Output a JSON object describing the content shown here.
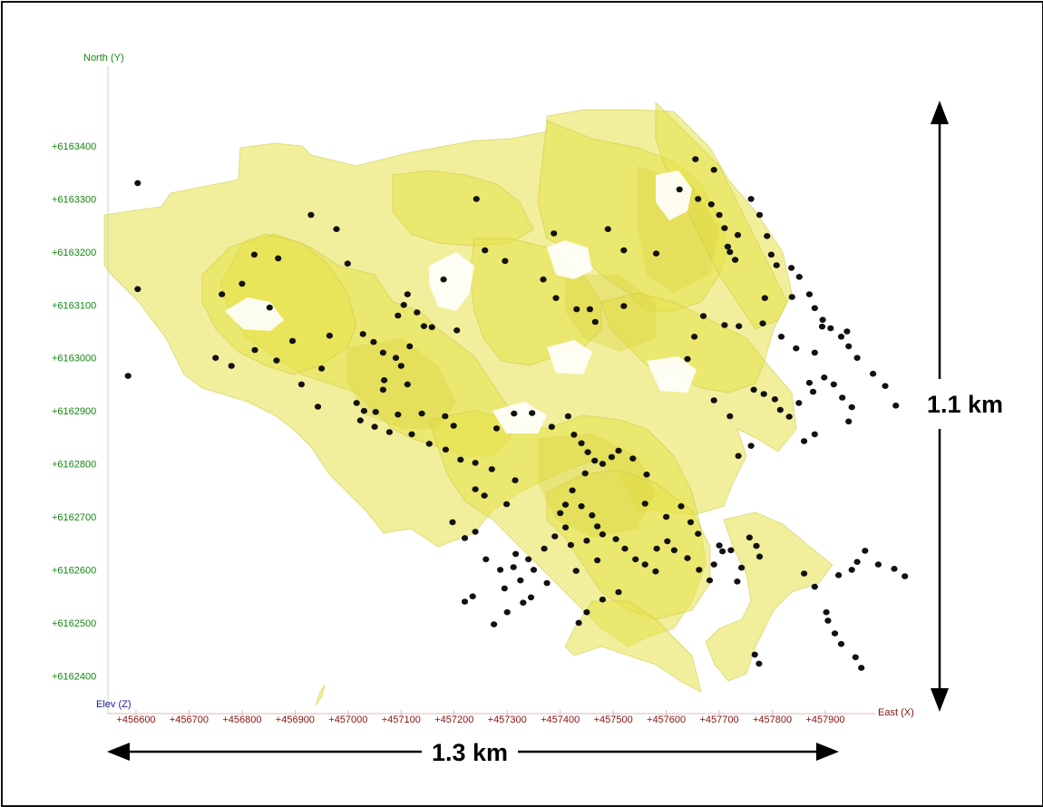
{
  "axes": {
    "north_title": "North (Y)",
    "east_title": "East (X)",
    "elev_title": "Elev (Z)",
    "north_ticks": [
      "+6163400",
      "+6163300",
      "+6163200",
      "+6163100",
      "+6163000",
      "+6162900",
      "+6162800",
      "+6162700",
      "+6162600",
      "+6162500",
      "+6162400"
    ],
    "east_ticks": [
      "+456600",
      "+456700",
      "+456800",
      "+456900",
      "+457000",
      "+457100",
      "+457200",
      "+457300",
      "+457400",
      "+457500",
      "+457600",
      "+457700",
      "+457800",
      "+457900"
    ]
  },
  "scale": {
    "horizontal_label": "1.3 km",
    "vertical_label": "1.1 km"
  },
  "colors": {
    "shell_fill": "#e5e14a",
    "shell_stroke": "#c9c43a",
    "drillhole": "#111111",
    "north_axis": "#118811",
    "east_axis": "#8a1010",
    "elev_axis": "#1a1a99"
  },
  "drillholes": [
    [
      456603,
      6163330
    ],
    [
      456603,
      6163130
    ],
    [
      456585,
      6162966
    ],
    [
      456762,
      6163120
    ],
    [
      456823,
      6163195
    ],
    [
      456800,
      6163140
    ],
    [
      456930,
      6163270
    ],
    [
      456978,
      6163243
    ],
    [
      456999,
      6163178
    ],
    [
      456868,
      6163188
    ],
    [
      456852,
      6163095
    ],
    [
      457112,
      6163120
    ],
    [
      457105,
      6163100
    ],
    [
      457130,
      6163086
    ],
    [
      457143,
      6163060
    ],
    [
      457094,
      6163080
    ],
    [
      457158,
      6163058
    ],
    [
      457180,
      6163148
    ],
    [
      457205,
      6163052
    ],
    [
      457258,
      6163203
    ],
    [
      457296,
      6163183
    ],
    [
      457242,
      6163300
    ],
    [
      457388,
      6163235
    ],
    [
      457368,
      6163148
    ],
    [
      457392,
      6163113
    ],
    [
      457431,
      6163092
    ],
    [
      457456,
      6163092
    ],
    [
      457520,
      6163098
    ],
    [
      457466,
      6163068
    ],
    [
      457490,
      6163243
    ],
    [
      457520,
      6163203
    ],
    [
      457581,
      6163197
    ],
    [
      457655,
      6163375
    ],
    [
      457690,
      6163355
    ],
    [
      457625,
      6163318
    ],
    [
      457660,
      6163300
    ],
    [
      457685,
      6163290
    ],
    [
      457700,
      6163270
    ],
    [
      457710,
      6163245
    ],
    [
      457735,
      6163232
    ],
    [
      457716,
      6163210
    ],
    [
      457720,
      6163200
    ],
    [
      457730,
      6163185
    ],
    [
      457760,
      6163300
    ],
    [
      457776,
      6163270
    ],
    [
      457790,
      6163230
    ],
    [
      457798,
      6163195
    ],
    [
      457808,
      6163175
    ],
    [
      457836,
      6163170
    ],
    [
      457851,
      6163153
    ],
    [
      457870,
      6163120
    ],
    [
      457880,
      6163094
    ],
    [
      457895,
      6163072
    ],
    [
      457910,
      6163056
    ],
    [
      457930,
      6163040
    ],
    [
      457944,
      6163022
    ],
    [
      457960,
      6163000
    ],
    [
      457990,
      6162970
    ],
    [
      458013,
      6162947
    ],
    [
      458033,
      6162910
    ],
    [
      457765,
      6162940
    ],
    [
      457784,
      6162932
    ],
    [
      457805,
      6162922
    ],
    [
      457815,
      6162902
    ],
    [
      457832,
      6162889
    ],
    [
      457850,
      6162915
    ],
    [
      457870,
      6162953
    ],
    [
      457877,
      6162936
    ],
    [
      457898,
      6162963
    ],
    [
      457916,
      6162950
    ],
    [
      457932,
      6162925
    ],
    [
      457950,
      6162907
    ],
    [
      457944,
      6162880
    ],
    [
      457880,
      6162856
    ],
    [
      457860,
      6162843
    ],
    [
      457760,
      6162834
    ],
    [
      457736,
      6162815
    ],
    [
      457720,
      6162890
    ],
    [
      457690,
      6162920
    ],
    [
      457640,
      6162998
    ],
    [
      457653,
      6163040
    ],
    [
      457670,
      6163079
    ],
    [
      457710,
      6163062
    ],
    [
      457737,
      6163060
    ],
    [
      457782,
      6163065
    ],
    [
      457786,
      6163113
    ],
    [
      457837,
      6163115
    ],
    [
      457817,
      6163040
    ],
    [
      457845,
      6163018
    ],
    [
      457894,
      6163059
    ],
    [
      457941,
      6163050
    ],
    [
      457880,
      6163010
    ],
    [
      456750,
      6163000
    ],
    [
      456780,
      6162985
    ],
    [
      456824,
      6163015
    ],
    [
      456865,
      6162995
    ],
    [
      456895,
      6163032
    ],
    [
      456912,
      6162950
    ],
    [
      456943,
      6162908
    ],
    [
      456950,
      6162980
    ],
    [
      456965,
      6163042
    ],
    [
      457028,
      6163045
    ],
    [
      457048,
      6163030
    ],
    [
      457066,
      6163010
    ],
    [
      457090,
      6163000
    ],
    [
      457116,
      6163022
    ],
    [
      457100,
      6162985
    ],
    [
      457112,
      6162950
    ],
    [
      457066,
      6162940
    ],
    [
      457068,
      6162958
    ],
    [
      457052,
      6162898
    ],
    [
      457030,
      6162900
    ],
    [
      457016,
      6162915
    ],
    [
      457023,
      6162882
    ],
    [
      457050,
      6162870
    ],
    [
      457078,
      6162860
    ],
    [
      457094,
      6162893
    ],
    [
      457139,
      6162895
    ],
    [
      457183,
      6162890
    ],
    [
      457199,
      6162872
    ],
    [
      457120,
      6162856
    ],
    [
      457153,
      6162838
    ],
    [
      457184,
      6162827
    ],
    [
      457212,
      6162808
    ],
    [
      457240,
      6162802
    ],
    [
      457271,
      6162790
    ],
    [
      457257,
      6162740
    ],
    [
      457299,
      6162724
    ],
    [
      457315,
      6162769
    ],
    [
      457240,
      6162752
    ],
    [
      457280,
      6162867
    ],
    [
      457313,
      6162895
    ],
    [
      457347,
      6162896
    ],
    [
      457384,
      6162870
    ],
    [
      457415,
      6162890
    ],
    [
      457426,
      6162855
    ],
    [
      457440,
      6162839
    ],
    [
      457452,
      6162822
    ],
    [
      457465,
      6162806
    ],
    [
      457480,
      6162800
    ],
    [
      457497,
      6162813
    ],
    [
      457510,
      6162825
    ],
    [
      457447,
      6162782
    ],
    [
      457423,
      6162750
    ],
    [
      457410,
      6162723
    ],
    [
      457400,
      6162707
    ],
    [
      457440,
      6162720
    ],
    [
      457460,
      6162703
    ],
    [
      457470,
      6162682
    ],
    [
      457480,
      6162667
    ],
    [
      457505,
      6162658
    ],
    [
      457522,
      6162640
    ],
    [
      457542,
      6162620
    ],
    [
      457560,
      6162610
    ],
    [
      457580,
      6162597
    ],
    [
      457582,
      6162640
    ],
    [
      457602,
      6162654
    ],
    [
      457615,
      6162637
    ],
    [
      457640,
      6162622
    ],
    [
      457662,
      6162600
    ],
    [
      457682,
      6162580
    ],
    [
      457690,
      6162610
    ],
    [
      457706,
      6162635
    ],
    [
      457560,
      6162725
    ],
    [
      457563,
      6162780
    ],
    [
      457537,
      6162810
    ],
    [
      457600,
      6162700
    ],
    [
      457628,
      6162720
    ],
    [
      457646,
      6162690
    ],
    [
      457660,
      6162668
    ],
    [
      457700,
      6162646
    ],
    [
      457722,
      6162637
    ],
    [
      457757,
      6162661
    ],
    [
      457770,
      6162645
    ],
    [
      457776,
      6162625
    ],
    [
      457742,
      6162604
    ],
    [
      457734,
      6162578
    ],
    [
      457510,
      6162558
    ],
    [
      457480,
      6162544
    ],
    [
      457450,
      6162520
    ],
    [
      457435,
      6162500
    ],
    [
      457350,
      6162600
    ],
    [
      457340,
      6162620
    ],
    [
      457370,
      6162640
    ],
    [
      457390,
      6162663
    ],
    [
      457410,
      6162680
    ],
    [
      457420,
      6162647
    ],
    [
      457450,
      6162655
    ],
    [
      457470,
      6162618
    ],
    [
      457430,
      6162598
    ],
    [
      457375,
      6162575
    ],
    [
      457316,
      6162630
    ],
    [
      457287,
      6162600
    ],
    [
      457295,
      6162565
    ],
    [
      457312,
      6162605
    ],
    [
      457325,
      6162580
    ],
    [
      457345,
      6162548
    ],
    [
      457330,
      6162538
    ],
    [
      457300,
      6162520
    ],
    [
      457275,
      6162497
    ],
    [
      457260,
      6162620
    ],
    [
      457220,
      6162660
    ],
    [
      457240,
      6162672
    ],
    [
      457197,
      6162690
    ],
    [
      457235,
      6162550
    ],
    [
      457220,
      6162540
    ],
    [
      457860,
      6162593
    ],
    [
      457880,
      6162568
    ],
    [
      457925,
      6162590
    ],
    [
      457950,
      6162600
    ],
    [
      457960,
      6162615
    ],
    [
      457975,
      6162636
    ],
    [
      458000,
      6162610
    ],
    [
      458030,
      6162602
    ],
    [
      458050,
      6162588
    ],
    [
      457902,
      6162520
    ],
    [
      457905,
      6162504
    ],
    [
      457918,
      6162480
    ],
    [
      457930,
      6162460
    ],
    [
      457957,
      6162435
    ],
    [
      457968,
      6162415
    ],
    [
      457767,
      6162440
    ],
    [
      457775,
      6162423
    ]
  ]
}
